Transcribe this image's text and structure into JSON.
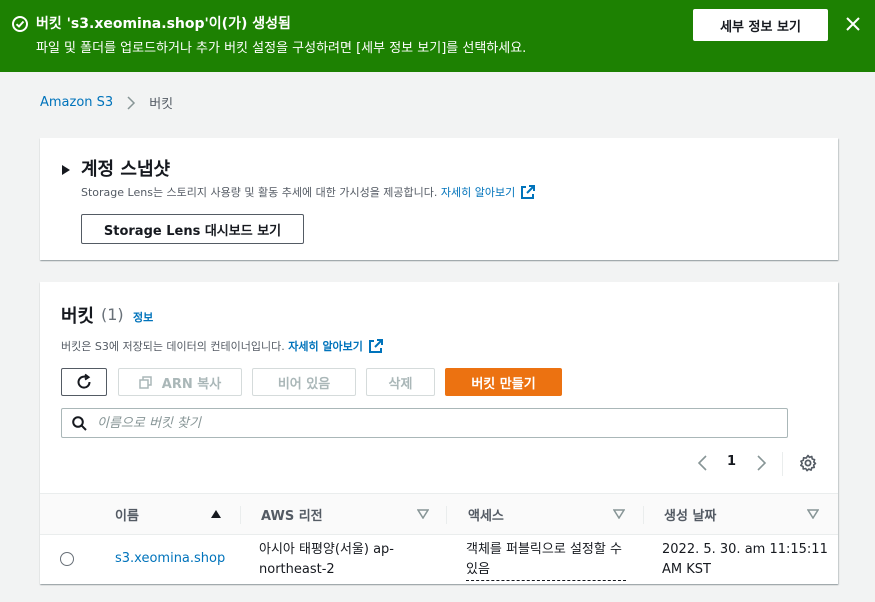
{
  "flash": {
    "title": "버킷 's3.xeomina.shop'이(가) 생성됨",
    "message": "파일 및 폴더를 업로드하거나 추가 버킷 설정을 구성하려면 [세부 정보 보기]를 선택하세요.",
    "details_button": "세부 정보 보기",
    "color": "#1d8102"
  },
  "breadcrumb": {
    "root": "Amazon S3",
    "current": "버킷"
  },
  "storage_lens": {
    "title": "계정 스냅샷",
    "description": "Storage Lens는 스토리지 사용량 및 활동 추세에 대한 가시성을 제공합니다.",
    "learn_more": "자세히 알아보기",
    "dashboard_button": "Storage Lens 대시보드 보기"
  },
  "buckets": {
    "title": "버킷",
    "count": "(1)",
    "info": "정보",
    "description": "버킷은 S3에 저장되는 데이터의 컨테이너입니다.",
    "learn_more": "자세히 알아보기",
    "actions": {
      "copy_arn": "ARN 복사",
      "empty": "비어 있음",
      "delete": "삭제",
      "create": "버킷 만들기"
    },
    "search_placeholder": "이름으로 버킷 찾기",
    "page": "1",
    "columns": [
      "이름",
      "AWS 리전",
      "액세스",
      "생성 날짜"
    ],
    "rows": [
      {
        "name": "s3.xeomina.shop",
        "region": "아시아 태평양(서울) ap-northeast-2",
        "access": "객체를 퍼블릭으로 설정할 수 있음",
        "created": "2022. 5. 30. am 11:15:11 AM KST"
      }
    ],
    "accent_color": "#ec7211",
    "link_color": "#0073bb"
  }
}
